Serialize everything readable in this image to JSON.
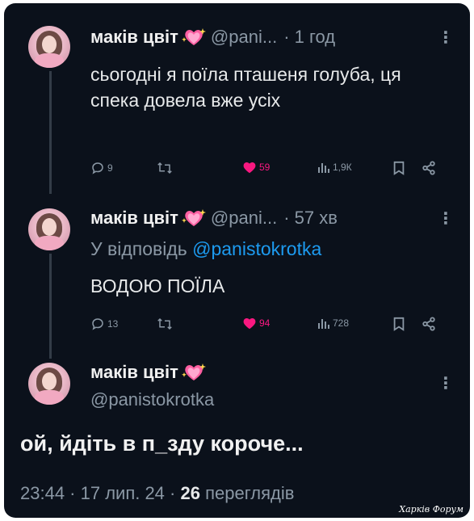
{
  "tweet1": {
    "name": "маків цвіт",
    "handle": "@pani...",
    "time": "· 1 год",
    "text": "сьогодні я поїла пташеня голуба, ця спека довела вже усіх",
    "replies": "9",
    "likes": "59",
    "views": "1,9К"
  },
  "tweet2": {
    "name": "маків цвіт",
    "handle": "@pani...",
    "time": "· 57 хв",
    "reply_prefix": "У відповідь",
    "reply_to": "@panistokrotka",
    "text": "ВОДОЮ ПОЇЛА",
    "replies": "13",
    "likes": "94",
    "views": "728"
  },
  "main": {
    "name": "маків цвіт",
    "handle": "@panistokrotka",
    "text": "ой, йдіть в п_зду короче...",
    "time": "23:44 · 17 лип. 24 ·",
    "views_count": "26",
    "views_label": "переглядів"
  },
  "watermark": "Харків Форум",
  "colors": {
    "background": "#0b111b",
    "like": "#f91880",
    "link": "#1d9bf0",
    "muted": "#8b98a5"
  },
  "icons": [
    "reply-icon",
    "retweet-icon",
    "heart-icon",
    "views-icon",
    "bookmark-icon",
    "share-icon",
    "more-icon",
    "sparkling-heart-icon"
  ]
}
